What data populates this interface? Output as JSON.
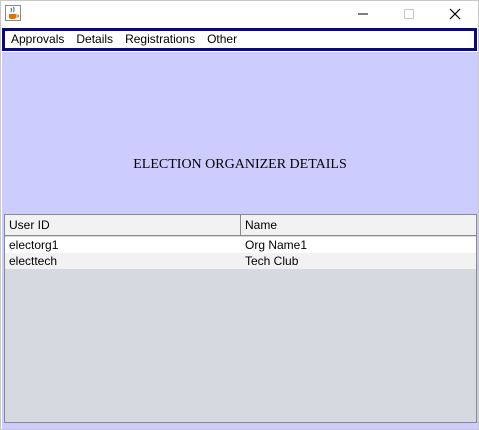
{
  "window": {
    "icon": "java-cup-icon",
    "controls": {
      "minimize": "minimize-icon",
      "maximize": "maximize-icon",
      "close": "close-icon"
    }
  },
  "menubar": {
    "items": [
      {
        "label": "Approvals"
      },
      {
        "label": "Details"
      },
      {
        "label": "Registrations"
      },
      {
        "label": "Other"
      }
    ]
  },
  "main": {
    "heading": "ELECTION ORGANIZER DETAILS",
    "background": "#ccccff"
  },
  "table": {
    "columns": [
      "User ID",
      "Name"
    ],
    "rows": [
      [
        "electorg1",
        "Org Name1"
      ],
      [
        "electtech",
        "Tech Club"
      ]
    ]
  },
  "colors": {
    "menu_border": "#0a0a80",
    "panel": "#ccccff",
    "table_empty": "#d6d9df"
  }
}
